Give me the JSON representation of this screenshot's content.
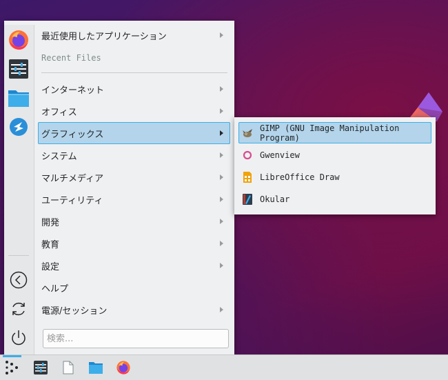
{
  "menu": {
    "items": [
      {
        "label": "最近使用したアプリケーション",
        "submenu": true
      },
      {
        "label": "Recent Files",
        "submenu": false
      },
      {
        "label": "インターネット",
        "submenu": true
      },
      {
        "label": "オフィス",
        "submenu": true
      },
      {
        "label": "グラフィックス",
        "submenu": true,
        "active": true
      },
      {
        "label": "システム",
        "submenu": true
      },
      {
        "label": "マルチメディア",
        "submenu": true
      },
      {
        "label": "ユーティリティ",
        "submenu": true
      },
      {
        "label": "開発",
        "submenu": true
      },
      {
        "label": "教育",
        "submenu": true
      },
      {
        "label": "設定",
        "submenu": true
      },
      {
        "label": "ヘルプ",
        "submenu": false
      },
      {
        "label": "電源/セッション",
        "submenu": true
      }
    ],
    "search_placeholder": "検索..."
  },
  "favorites": [
    "firefox-icon",
    "system-settings-icon",
    "file-manager-icon",
    "discover-icon"
  ],
  "session_icons": [
    "logout-icon",
    "restart-icon",
    "shutdown-icon"
  ],
  "submenu": {
    "items": [
      {
        "label": "GIMP (GNU Image Manipulation Program)",
        "icon": "gimp-icon",
        "active": true
      },
      {
        "label": "Gwenview",
        "icon": "gwenview-icon"
      },
      {
        "label": "LibreOffice Draw",
        "icon": "libreoffice-draw-icon"
      },
      {
        "label": "Okular",
        "icon": "okular-icon"
      }
    ]
  },
  "taskbar": {
    "items": [
      "application-launcher-icon",
      "system-settings-icon",
      "document-icon",
      "file-manager-icon",
      "firefox-icon"
    ]
  },
  "colors": {
    "accent": "#3daee9",
    "highlight": "#b3d4ea",
    "menu_bg": "#eff0f1"
  }
}
